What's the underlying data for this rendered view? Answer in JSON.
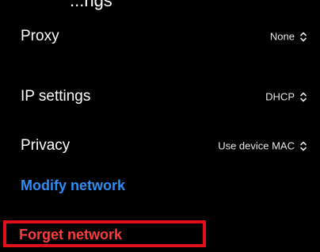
{
  "header": {
    "clipped_title": "...ngs"
  },
  "settings": [
    {
      "label": "Proxy",
      "value": "None"
    },
    {
      "label": "IP settings",
      "value": "DHCP"
    },
    {
      "label": "Privacy",
      "value": "Use device MAC"
    }
  ],
  "actions": {
    "modify_label": "Modify network",
    "forget_label": "Forget network"
  },
  "colors": {
    "background": "#000000",
    "link_blue": "#2f8ef4",
    "danger_red": "#ff3b3b",
    "highlight_box": "#e0101a"
  },
  "icons": {
    "dropdown": "updown-chevron-icon"
  }
}
